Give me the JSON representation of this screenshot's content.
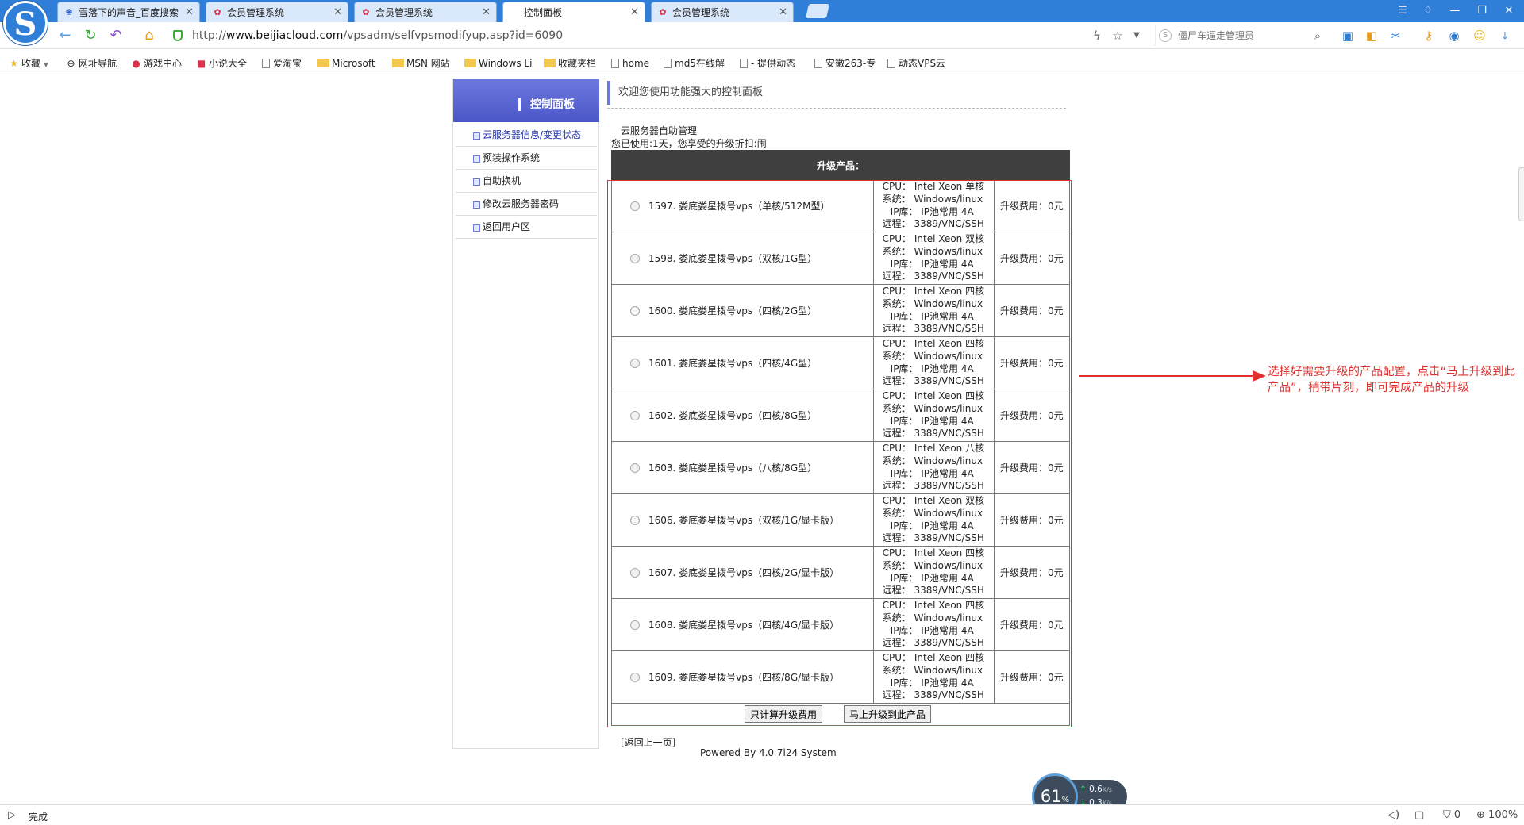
{
  "browser": {
    "tabs": [
      {
        "title": "雪落下的声音_百度搜索",
        "icon": "baidu-paw-icon"
      },
      {
        "title": "会员管理系统",
        "icon": "flower-icon"
      },
      {
        "title": "会员管理系统",
        "icon": "flower-icon"
      },
      {
        "title": "控制面板",
        "icon": "none"
      },
      {
        "title": "会员管理系统",
        "icon": "flower-icon"
      }
    ],
    "url_prefix": "http://",
    "url_host": "www.beijiacloud.com",
    "url_path": "/vpsadm/selfvpsmodifyup.asp?id=6090",
    "search_placeholder": "僵尸车逼走管理员",
    "bookmarks": [
      {
        "label": "收藏",
        "icon": "star-icon"
      },
      {
        "label": "网址导航",
        "icon": "globe-icon"
      },
      {
        "label": "游戏中心",
        "icon": "game-icon"
      },
      {
        "label": "小说大全",
        "icon": "book-icon"
      },
      {
        "label": "爱淘宝",
        "icon": "page-icon"
      },
      {
        "label": "Microsoft",
        "icon": "folder-icon"
      },
      {
        "label": "MSN 网站",
        "icon": "folder-icon"
      },
      {
        "label": "Windows Li",
        "icon": "folder-icon"
      },
      {
        "label": "收藏夹栏",
        "icon": "folder-icon"
      },
      {
        "label": "home",
        "icon": "page-icon"
      },
      {
        "label": "md5在线解",
        "icon": "page-icon"
      },
      {
        "label": "- 提供动态",
        "icon": "page-icon"
      },
      {
        "label": "安徽263-专",
        "icon": "page-icon"
      },
      {
        "label": "动态VPS云",
        "icon": "page-icon"
      }
    ],
    "status": "完成",
    "zoom": "100%",
    "status_count": "0"
  },
  "sidebar": {
    "title": "控制面板",
    "items": [
      {
        "label": "云服务器信息/变更状态"
      },
      {
        "label": "预装操作系统"
      },
      {
        "label": "自助换机"
      },
      {
        "label": "修改云服务器密码"
      },
      {
        "label": "返回用户区"
      }
    ]
  },
  "main": {
    "welcome": "欢迎您使用功能强大的控制面板",
    "section_title": "云服务器自助管理",
    "usage": "您已使用:1天，您享受的升级折扣:闹",
    "table_header": "升级产品：",
    "products": [
      {
        "name": "1597. 娄底娄星拨号vps（单核/512M型）",
        "cpu": "CPU： Intel Xeon 单核",
        "os": "系统： Windows/linux",
        "ip": "IP库： IP池常用 4A",
        "remote": "远程： 3389/VNC/SSH",
        "fee": "升级费用：0元"
      },
      {
        "name": "1598. 娄底娄星拨号vps（双核/1G型）",
        "cpu": "CPU： Intel Xeon 双核",
        "os": "系统： Windows/linux",
        "ip": "IP库： IP池常用 4A",
        "remote": "远程： 3389/VNC/SSH",
        "fee": "升级费用：0元"
      },
      {
        "name": "1600. 娄底娄星拨号vps（四核/2G型）",
        "cpu": "CPU： Intel Xeon 四核",
        "os": "系统： Windows/linux",
        "ip": "IP库： IP池常用 4A",
        "remote": "远程： 3389/VNC/SSH",
        "fee": "升级费用：0元"
      },
      {
        "name": "1601. 娄底娄星拨号vps（四核/4G型）",
        "cpu": "CPU： Intel Xeon 四核",
        "os": "系统： Windows/linux",
        "ip": "IP库： IP池常用 4A",
        "remote": "远程： 3389/VNC/SSH",
        "fee": "升级费用：0元"
      },
      {
        "name": "1602. 娄底娄星拨号vps（四核/8G型）",
        "cpu": "CPU： Intel Xeon 四核",
        "os": "系统： Windows/linux",
        "ip": "IP库： IP池常用 4A",
        "remote": "远程： 3389/VNC/SSH",
        "fee": "升级费用：0元"
      },
      {
        "name": "1603. 娄底娄星拨号vps（八核/8G型）",
        "cpu": "CPU： Intel Xeon 八核",
        "os": "系统： Windows/linux",
        "ip": "IP库： IP池常用 4A",
        "remote": "远程： 3389/VNC/SSH",
        "fee": "升级费用：0元"
      },
      {
        "name": "1606. 娄底娄星拨号vps（双核/1G/显卡版）",
        "cpu": "CPU： Intel Xeon 双核",
        "os": "系统： Windows/linux",
        "ip": "IP库： IP池常用 4A",
        "remote": "远程： 3389/VNC/SSH",
        "fee": "升级费用：0元"
      },
      {
        "name": "1607. 娄底娄星拨号vps（四核/2G/显卡版）",
        "cpu": "CPU： Intel Xeon 四核",
        "os": "系统： Windows/linux",
        "ip": "IP库： IP池常用 4A",
        "remote": "远程： 3389/VNC/SSH",
        "fee": "升级费用：0元"
      },
      {
        "name": "1608. 娄底娄星拨号vps（四核/4G/显卡版）",
        "cpu": "CPU： Intel Xeon 四核",
        "os": "系统： Windows/linux",
        "ip": "IP库： IP池常用 4A",
        "remote": "远程： 3389/VNC/SSH",
        "fee": "升级费用：0元"
      },
      {
        "name": "1609. 娄底娄星拨号vps（四核/8G/显卡版）",
        "cpu": "CPU： Intel Xeon 四核",
        "os": "系统： Windows/linux",
        "ip": "IP库： IP池常用 4A",
        "remote": "远程： 3389/VNC/SSH",
        "fee": "升级费用：0元"
      }
    ],
    "btn_calc": "只计算升级费用",
    "btn_upgrade": "马上升级到此产品",
    "back_link": "[返回上一页]",
    "powered_by": "Powered By 4.0 7i24 System"
  },
  "annotation": {
    "text": "选择好需要升级的产品配置，点击“马上升级到此产品”，稍带片刻，即可完成产品的升级",
    "color": "#e03030"
  },
  "net_widget": {
    "percent": "61",
    "percent_unit": "%",
    "up": "0.6",
    "up_unit": "K/s",
    "down": "0.3",
    "down_unit": "K/s"
  },
  "colors": {
    "browser_blue": "#2f7fd8",
    "sidebar_header": "#5a66d4",
    "table_header": "#3f3f3f",
    "highlight_red": "#e03030"
  }
}
